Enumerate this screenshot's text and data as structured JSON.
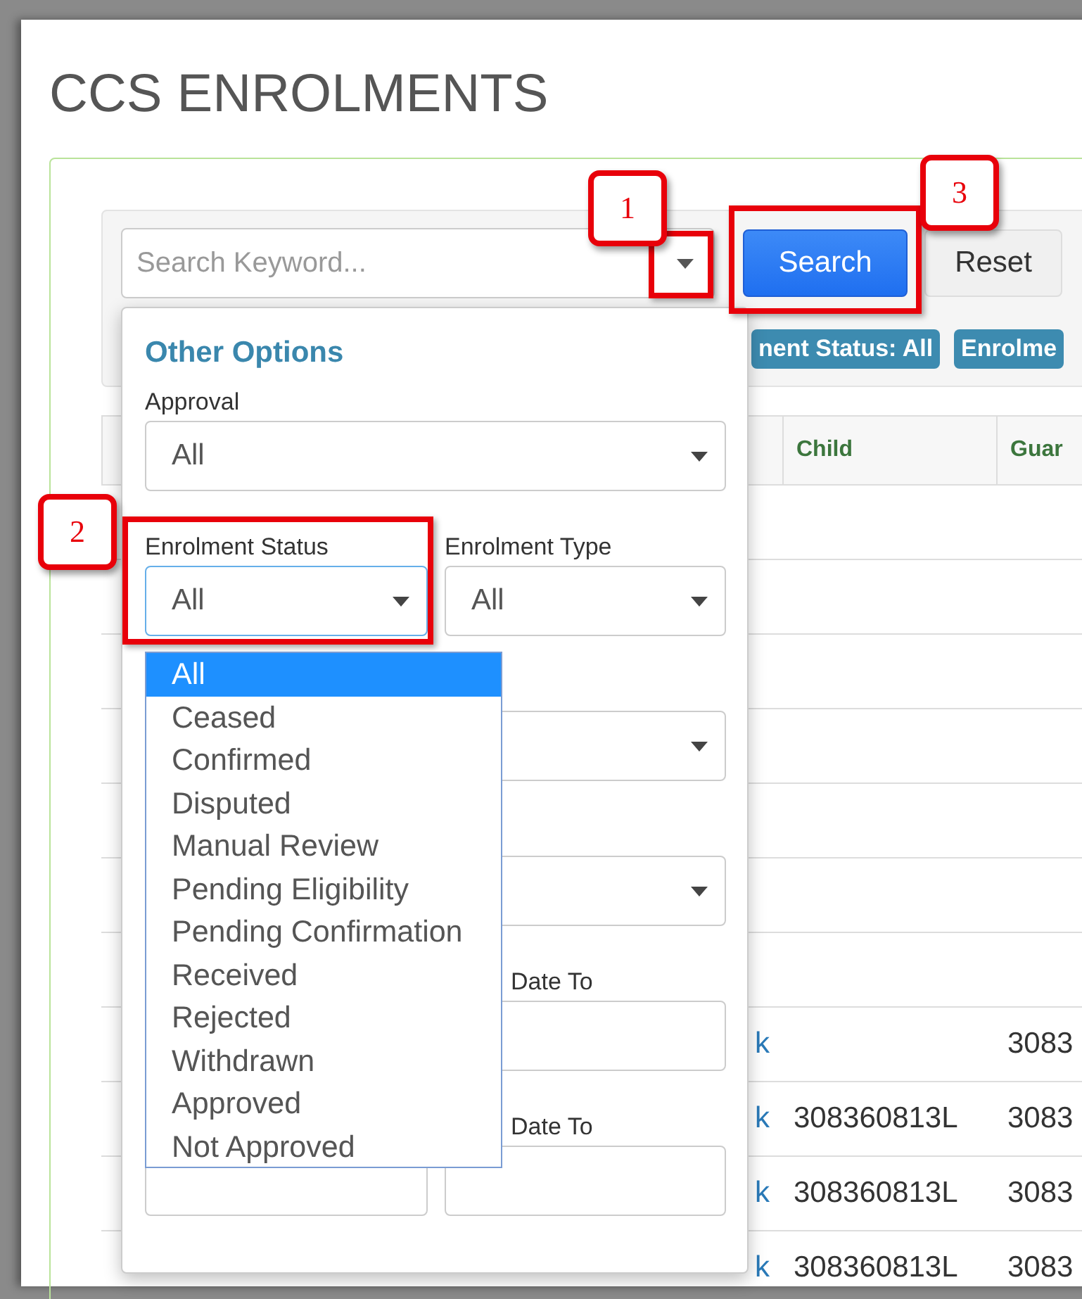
{
  "page": {
    "title": "CCS ENROLMENTS"
  },
  "search": {
    "placeholder": "Search Keyword...",
    "buttons": [
      {
        "label": "Search",
        "kind": "primary"
      },
      {
        "label": "Reset",
        "kind": "default"
      }
    ]
  },
  "filter_tags": [
    "nent Status: All",
    "Enrolme"
  ],
  "table": {
    "columns": [
      "Child",
      "Guar"
    ],
    "rows": [
      {
        "link": "k",
        "guardian": "3083"
      },
      {
        "link": "k",
        "child": "308360813L",
        "guardian": "3083"
      },
      {
        "link": "k",
        "child": "308360813L",
        "guardian": "3083"
      },
      {
        "link": "k",
        "child": "308360813L",
        "guardian": "3083"
      }
    ]
  },
  "other_options": {
    "title": "Other Options",
    "rows": [
      {
        "full": {
          "label": "Approval",
          "kind": "select",
          "value": "All"
        }
      },
      {
        "left": {
          "label": "Enrolment Status",
          "kind": "select",
          "value": "All",
          "open": true
        },
        "right": {
          "label": "Enrolment Type",
          "kind": "select",
          "value": "All"
        }
      },
      {
        "right": {
          "kind": "select"
        }
      },
      {
        "right": {
          "kind": "select"
        }
      },
      {
        "right": {
          "label": "Date To",
          "kind": "input"
        }
      },
      {
        "left": {
          "kind": "input"
        },
        "right": {
          "label": "Date To",
          "kind": "input"
        }
      }
    ]
  },
  "status_options": [
    {
      "label": "All",
      "selected": true
    },
    {
      "label": "Ceased",
      "selected": false
    },
    {
      "label": "Confirmed",
      "selected": false
    },
    {
      "label": "Disputed",
      "selected": false
    },
    {
      "label": "Manual Review",
      "selected": false
    },
    {
      "label": "Pending Eligibility",
      "selected": false
    },
    {
      "label": "Pending Confirmation",
      "selected": false
    },
    {
      "label": "Received",
      "selected": false
    },
    {
      "label": "Rejected",
      "selected": false
    },
    {
      "label": "Withdrawn",
      "selected": false
    },
    {
      "label": "Approved",
      "selected": false
    },
    {
      "label": "Not Approved",
      "selected": false
    }
  ],
  "callouts": [
    {
      "number": "1",
      "kind": "overlay"
    },
    {
      "number": "3",
      "kind": "overlay"
    },
    {
      "number": "2",
      "kind": "field"
    }
  ]
}
